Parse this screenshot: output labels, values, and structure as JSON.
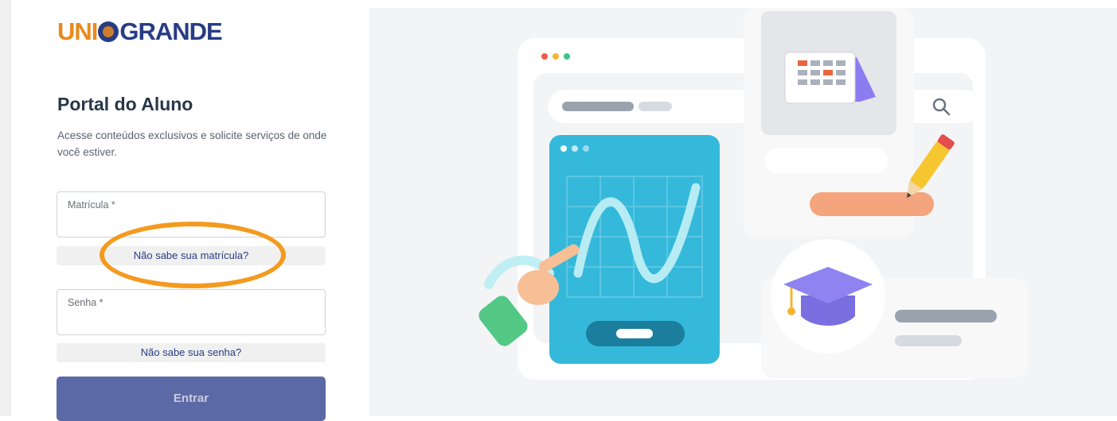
{
  "brand": {
    "logo_part1": "UNI",
    "logo_part2": "GRANDE",
    "logo_icon": "seal-icon"
  },
  "login": {
    "title": "Portal do Aluno",
    "subtitle": "Acesse conteúdos exclusivos e solicite serviços de onde você estiver.",
    "matricula_label": "Matrícula *",
    "matricula_value": "",
    "forgot_matricula": "Não sabe sua matrícula?",
    "senha_label": "Senha *",
    "senha_value": "",
    "forgot_senha": "Não sabe sua senha?",
    "submit_label": "Entrar"
  },
  "colors": {
    "brand_orange": "#e98a1c",
    "brand_blue": "#283c84",
    "button": "#5b6aa6",
    "highlight_ring": "#f39a1f"
  },
  "illustration": {
    "icons": [
      "browser-window-icon",
      "calendar-icon",
      "search-icon",
      "pencil-icon",
      "chart-tablet-icon",
      "pointing-hand-icon",
      "graduation-cap-icon"
    ]
  }
}
